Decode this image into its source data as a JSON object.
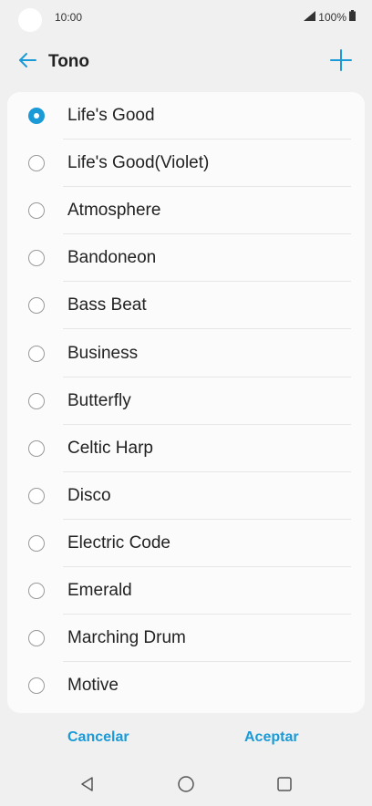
{
  "status_bar": {
    "time": "10:00",
    "battery": "100%"
  },
  "header": {
    "title": "Tono",
    "back_icon": "arrow-left-icon",
    "add_icon": "plus-icon"
  },
  "ringtones": {
    "selected_index": 0,
    "items": [
      {
        "label": "Life's Good"
      },
      {
        "label": "Life's Good(Violet)"
      },
      {
        "label": "Atmosphere"
      },
      {
        "label": "Bandoneon"
      },
      {
        "label": "Bass Beat"
      },
      {
        "label": "Business"
      },
      {
        "label": "Butterfly"
      },
      {
        "label": "Celtic Harp"
      },
      {
        "label": "Disco"
      },
      {
        "label": "Electric Code"
      },
      {
        "label": "Emerald"
      },
      {
        "label": "Marching Drum"
      },
      {
        "label": "Motive"
      }
    ]
  },
  "actions": {
    "cancel_label": "Cancelar",
    "accept_label": "Aceptar"
  },
  "colors": {
    "accent": "#1a9ad6",
    "background": "#f0f0f0",
    "card": "#fbfbfb"
  }
}
